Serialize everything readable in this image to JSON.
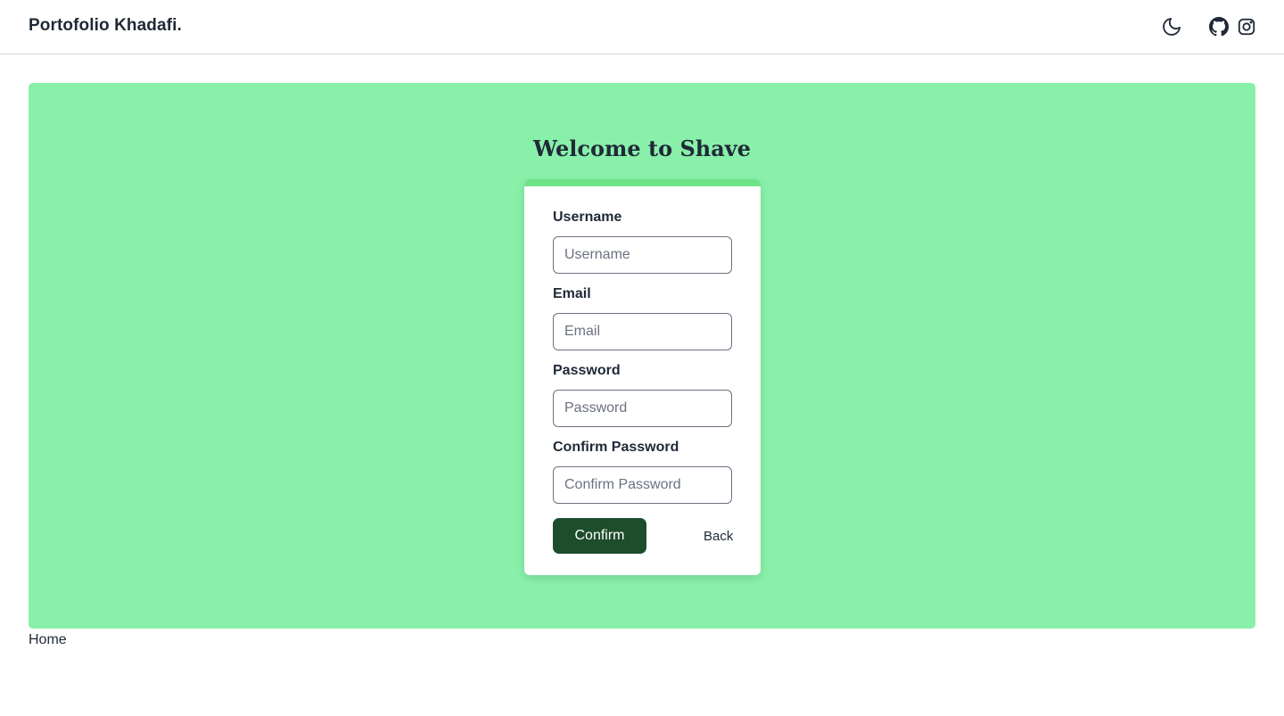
{
  "navbar": {
    "brand": "Portofolio Khadafi.",
    "icons": [
      "moon-icon",
      "github-icon",
      "instagram-icon"
    ]
  },
  "hero": {
    "title": "Welcome to Shave",
    "background": "#89f0aa"
  },
  "form": {
    "accent": "#6ee38a",
    "fields": [
      {
        "label": "Username",
        "placeholder": "Username",
        "value": ""
      },
      {
        "label": "Email",
        "placeholder": "Email",
        "value": ""
      },
      {
        "label": "Password",
        "placeholder": "Password",
        "value": ""
      },
      {
        "label": "Confirm Password",
        "placeholder": "Confirm Password",
        "value": ""
      }
    ],
    "confirm_label": "Confirm",
    "confirm_color": "#1e4d2b",
    "back_label": "Back"
  },
  "footer": {
    "home_label": "Home"
  }
}
